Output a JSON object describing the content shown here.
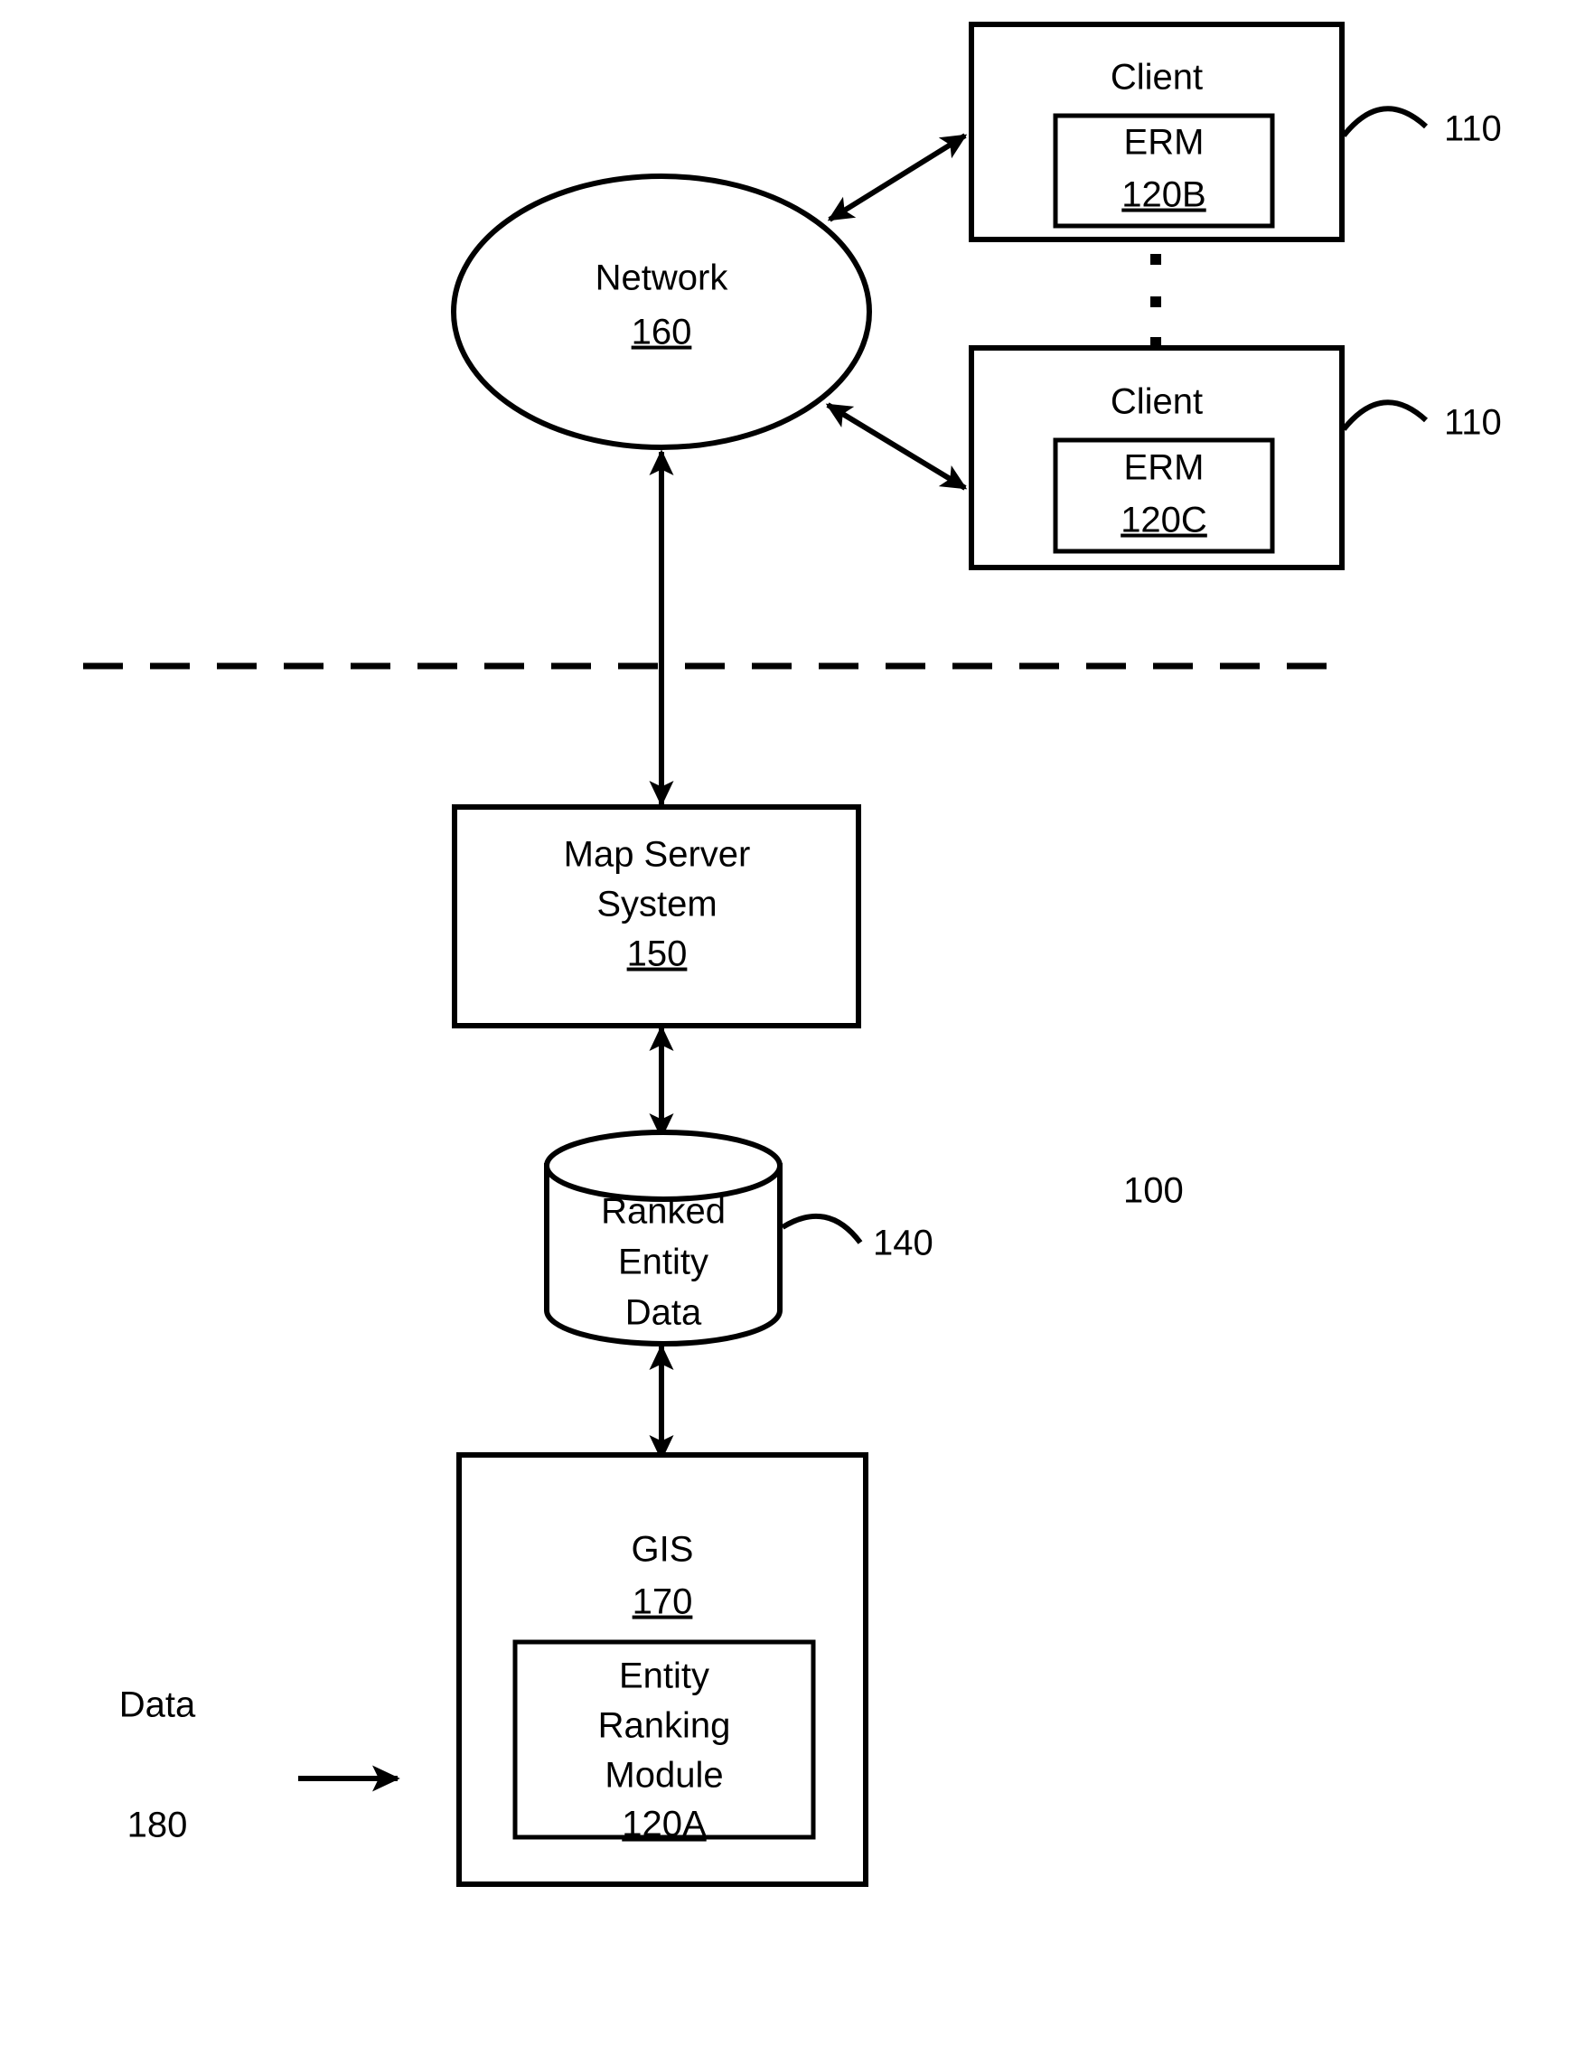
{
  "diagram": {
    "figure_ref": "100",
    "nodes": {
      "network": {
        "label": "Network",
        "ref": "160"
      },
      "client_top": {
        "label": "Client",
        "ref": "110",
        "module": {
          "label": "ERM",
          "ref": "120B"
        }
      },
      "client_bottom": {
        "label": "Client",
        "ref": "110",
        "module": {
          "label": "ERM",
          "ref": "120C"
        }
      },
      "map_server": {
        "label_line1": "Map Server",
        "label_line2": "System",
        "ref": "150"
      },
      "database": {
        "label_line1": "Ranked",
        "label_line2": "Entity",
        "label_line3": "Data",
        "ref": "140"
      },
      "gis": {
        "label": "GIS",
        "ref": "170",
        "module": {
          "label_line1": "Entity",
          "label_line2": "Ranking",
          "label_line3": "Module",
          "ref": "120A"
        }
      },
      "data_input": {
        "label": "Data",
        "ref": "180"
      }
    },
    "colors": {
      "stroke": "#000000",
      "background": "#ffffff"
    }
  }
}
